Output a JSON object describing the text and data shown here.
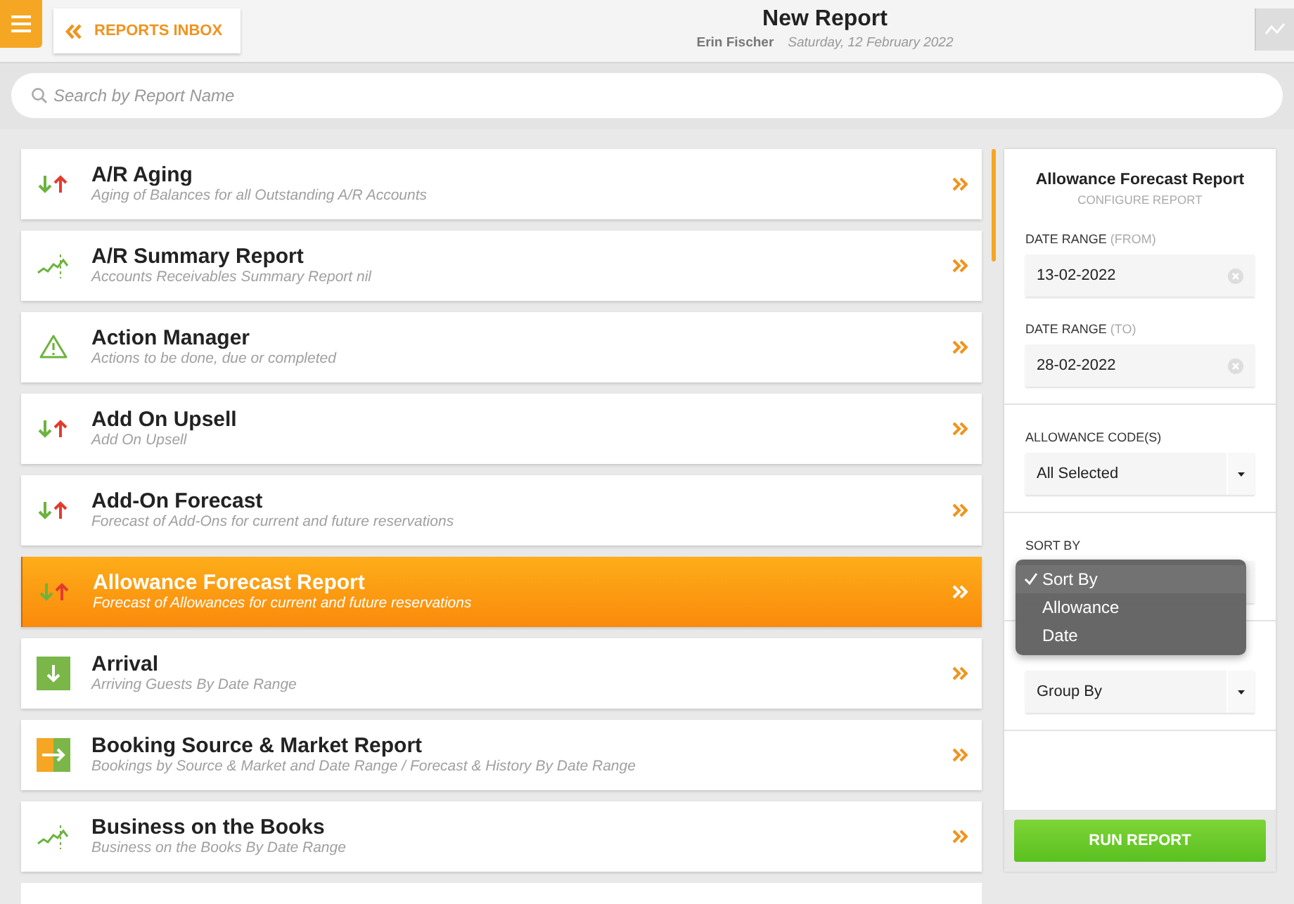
{
  "header": {
    "inbox_button": "REPORTS INBOX",
    "title": "New Report",
    "user": "Erin Fischer",
    "date": "Saturday, 12 February 2022"
  },
  "search": {
    "placeholder": "Search by Report Name"
  },
  "reports": [
    {
      "title": "A/R Aging",
      "subtitle": "Aging of Balances for all Outstanding A/R Accounts",
      "kind": "arrows",
      "selected": false
    },
    {
      "title": "A/R Summary Report",
      "subtitle": "Accounts Receivables Summary Report nil",
      "kind": "chart",
      "selected": false
    },
    {
      "title": "Action Manager",
      "subtitle": "Actions to be done, due or completed",
      "kind": "warning",
      "selected": false
    },
    {
      "title": "Add On Upsell",
      "subtitle": "Add On Upsell",
      "kind": "arrows",
      "selected": false
    },
    {
      "title": "Add-On Forecast",
      "subtitle": "Forecast of Add-Ons for current and future reservations",
      "kind": "arrows",
      "selected": false
    },
    {
      "title": "Allowance Forecast Report",
      "subtitle": "Forecast of Allowances for current and future reservations",
      "kind": "arrows",
      "selected": true
    },
    {
      "title": "Arrival",
      "subtitle": "Arriving Guests By Date Range",
      "kind": "arrival",
      "selected": false
    },
    {
      "title": "Booking Source & Market Report",
      "subtitle": "Bookings by Source & Market and Date Range / Forecast & History By Date Range",
      "kind": "booking",
      "selected": false
    },
    {
      "title": "Business on the Books",
      "subtitle": "Business on the Books By Date Range",
      "kind": "chart",
      "selected": false
    }
  ],
  "config": {
    "title": "Allowance Forecast Report",
    "subtitle": "CONFIGURE REPORT",
    "date_from": {
      "label": "DATE RANGE",
      "hint": "(FROM)",
      "value": "13-02-2022"
    },
    "date_to": {
      "label": "DATE RANGE",
      "hint": "(TO)",
      "value": "28-02-2022"
    },
    "allowance_codes": {
      "label": "ALLOWANCE CODE(S)",
      "value": "All Selected"
    },
    "sort_by": {
      "label": "SORT BY",
      "options": [
        {
          "label": "Sort By",
          "selected": true
        },
        {
          "label": "Allowance",
          "selected": false
        },
        {
          "label": "Date",
          "selected": false
        }
      ]
    },
    "group_by": {
      "value": "Group By"
    },
    "run_button": "RUN REPORT"
  }
}
